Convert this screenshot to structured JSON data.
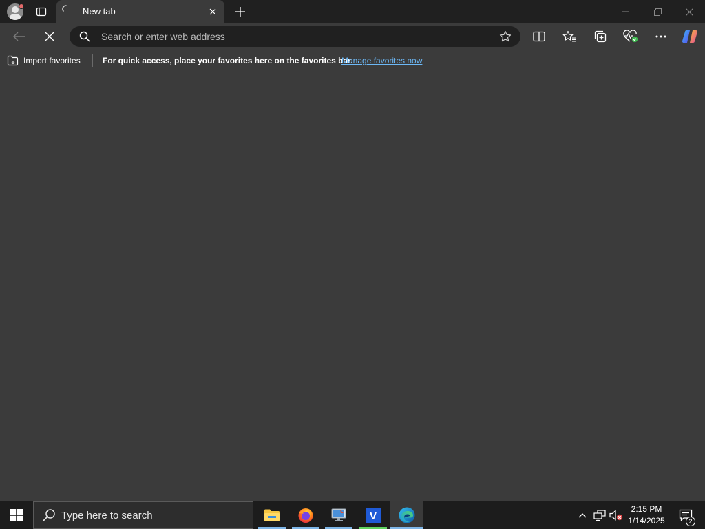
{
  "tab": {
    "title": "New tab"
  },
  "addressbar": {
    "placeholder": "Search or enter web address"
  },
  "favorites_bar": {
    "import_label": "Import favorites",
    "message": "For quick access, place your favorites here on the favorites bar.",
    "link_label": "Manage favorites now",
    "link_color": "#6cb8f6"
  },
  "taskbar": {
    "search_placeholder": "Type here to search",
    "apps": [
      "file-explorer",
      "firefox",
      "remote-desktop",
      "v-app",
      "edge"
    ],
    "clock_time": "2:15 PM",
    "clock_date": "1/14/2025",
    "notification_count": "2"
  },
  "colors": {
    "titlebar": "#202020",
    "toolbar": "#3b3b3b",
    "taskbar": "#1c1c1c",
    "accent": "#7eb6e8"
  }
}
